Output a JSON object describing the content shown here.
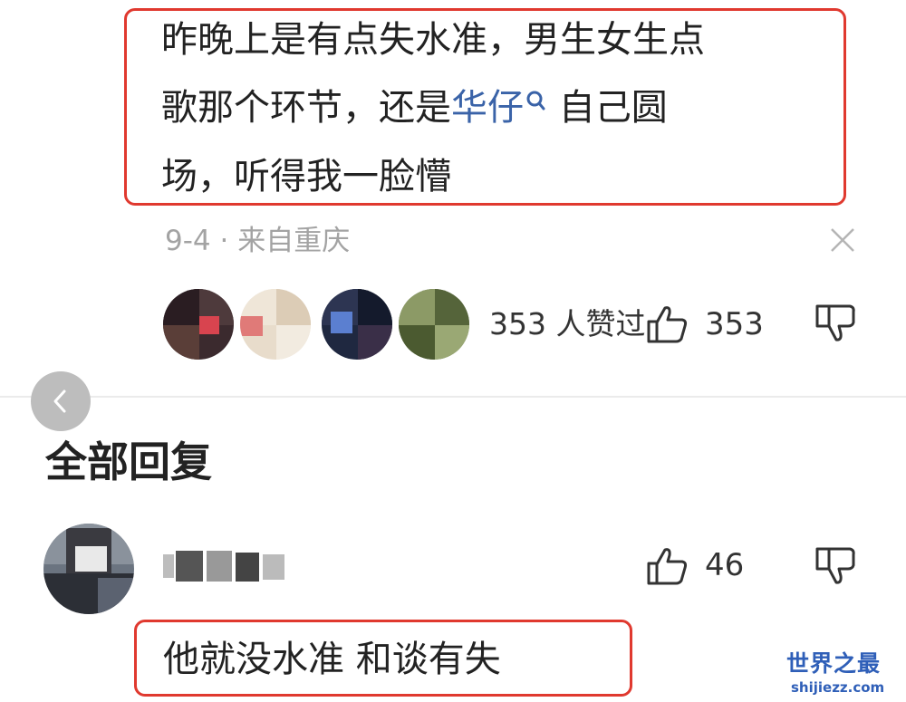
{
  "comment": {
    "line1": "昨晚上是有点失水准，男生女生点",
    "line2_before": "歌那个环节，还是",
    "line2_link": "华仔",
    "line2_after": " 自己圆",
    "line3": "场，听得我一脸懵"
  },
  "meta": {
    "date_location": "9-4 · 来自重庆"
  },
  "likes": {
    "likers_text": "353 人赞过",
    "count": "353",
    "link_icon": "search-icon"
  },
  "replies": {
    "title": "全部回复",
    "items": [
      {
        "like_count": "46",
        "text": "他就没水准 和谈有失"
      }
    ]
  },
  "watermark": {
    "cn": "世界之最",
    "en": "shijiezz.com"
  },
  "colors": {
    "highlight_border": "#e0392f",
    "link": "#3a63a8",
    "watermark": "#2f5fb8"
  }
}
